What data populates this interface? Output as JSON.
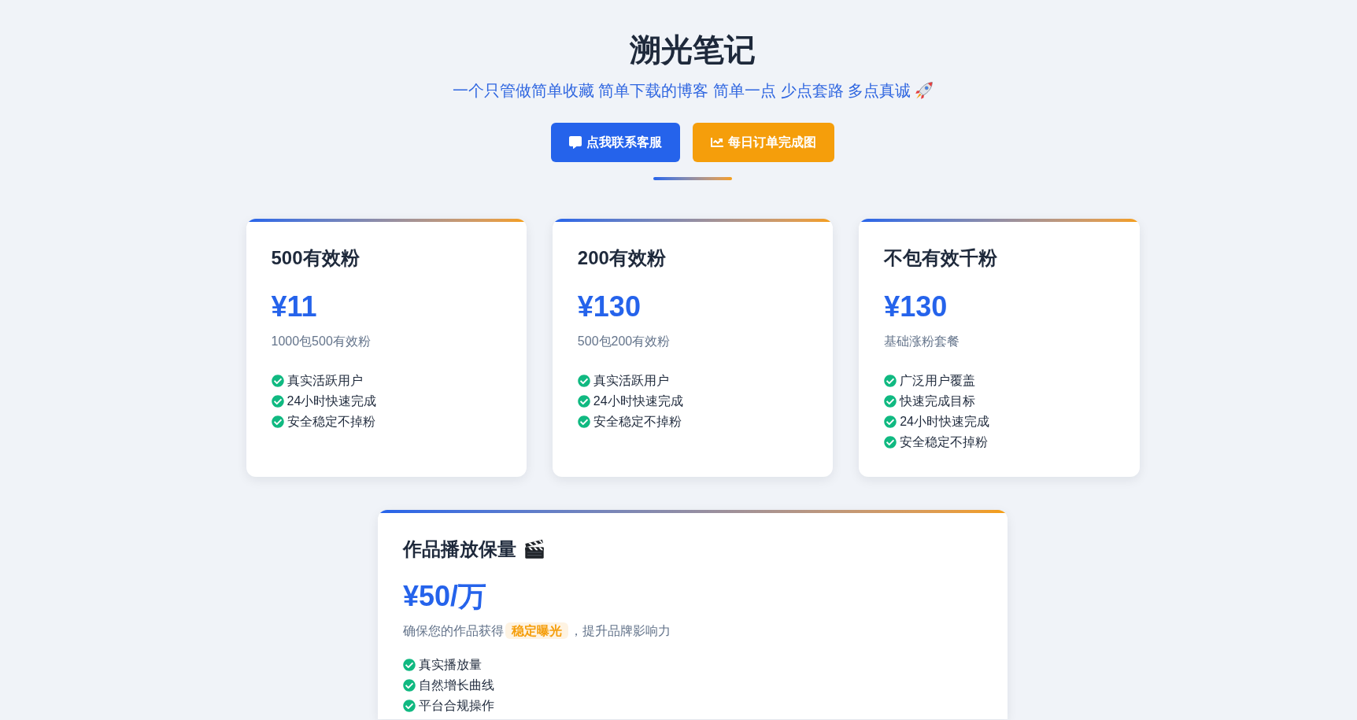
{
  "header": {
    "title": "溯光笔记",
    "subtitle": "一个只管做简单收藏 简单下载的博客 简单一点 少点套路 多点真诚",
    "buttons": [
      {
        "label": "点我联系客服",
        "kind": "contact"
      },
      {
        "label": "每日订单完成图",
        "kind": "orders"
      }
    ]
  },
  "plans": [
    {
      "name": "500有效粉",
      "price": "¥11",
      "description": "1000包500有效粉",
      "features": [
        "真实活跃用户",
        "24小时快速完成",
        "安全稳定不掉粉"
      ]
    },
    {
      "name": "200有效粉",
      "price": "¥130",
      "description": "500包200有效粉",
      "features": [
        "真实活跃用户",
        "24小时快速完成",
        "安全稳定不掉粉"
      ]
    },
    {
      "name": "不包有效千粉",
      "price": "¥130",
      "description": "基础涨粉套餐",
      "features": [
        "广泛用户覆盖",
        "快速完成目标",
        "24小时快速完成",
        "安全稳定不掉粉"
      ]
    }
  ],
  "featured_plan": {
    "name": "作品播放保量",
    "price": "¥50/万",
    "description": "确保您的作品获得**稳定曝光**，提升品牌影响力",
    "features": [
      "真实播放量",
      "自然增长曲线",
      "平台合规操作"
    ]
  }
}
